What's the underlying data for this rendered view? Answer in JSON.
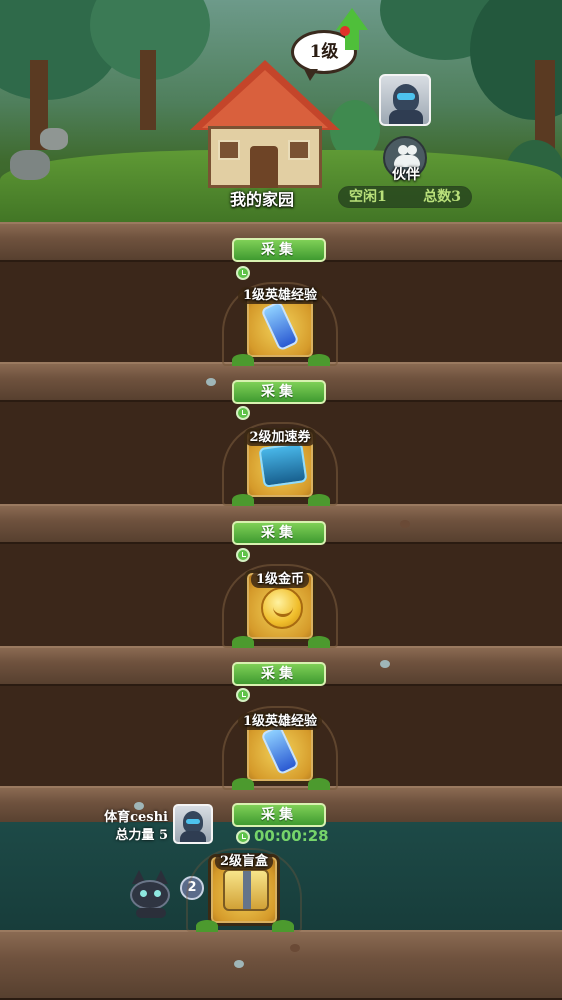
{
  "home": {
    "level": "1级",
    "title": "我的家园",
    "partner_label": "伙伴",
    "idle": "空闲1",
    "total": "总数3"
  },
  "rows": [
    {
      "button": "采集",
      "item": "1级英雄经验",
      "icon": "exp-vial-icon"
    },
    {
      "button": "采集",
      "item": "2级加速券",
      "icon": "speed-ticket-icon"
    },
    {
      "button": "采集",
      "item": "1级金币",
      "icon": "gold-coin-icon"
    },
    {
      "button": "采集",
      "item": "1级英雄经验",
      "icon": "exp-vial-icon"
    },
    {
      "button": "采集",
      "item": "2级盲盒",
      "icon": "blind-box-icon",
      "timer": "00:00:28"
    }
  ],
  "user": {
    "name": "体育ceshi",
    "power": "总力量  5",
    "pet_count": "2"
  },
  "colors": {
    "collect_button": "#5cb841",
    "timer_text": "#76d46a",
    "soil": "#3c281b",
    "active_layer": "#1d4a47"
  }
}
